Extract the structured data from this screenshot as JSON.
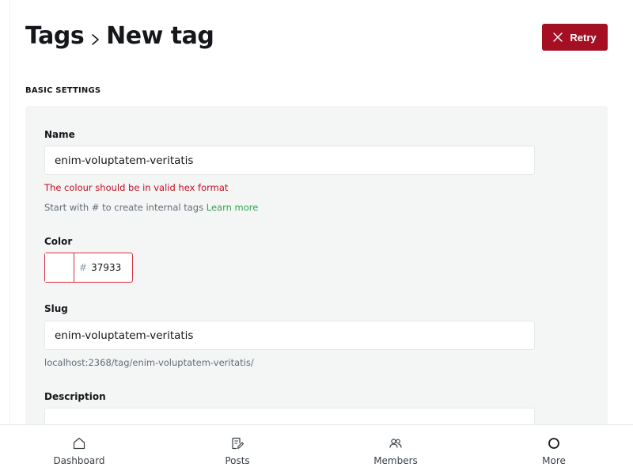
{
  "header": {
    "breadcrumb_parent": "Tags",
    "breadcrumb_current": "New tag",
    "retry_label": "Retry"
  },
  "section": {
    "title": "BASIC SETTINGS"
  },
  "form": {
    "name": {
      "label": "Name",
      "value": "enim-voluptatem-veritatis",
      "error": "The colour should be in valid hex format",
      "hint": "Start with # to create internal tags",
      "hint_link": "Learn more"
    },
    "color": {
      "label": "Color",
      "hash": "#",
      "value": "37933"
    },
    "slug": {
      "label": "Slug",
      "value": "enim-voluptatem-veritatis",
      "url_preview": "localhost:2368/tag/enim-voluptatem-veritatis/"
    },
    "description": {
      "label": "Description",
      "value": ""
    }
  },
  "bottom_nav": {
    "items": [
      {
        "label": "Dashboard",
        "icon": "house-icon"
      },
      {
        "label": "Posts",
        "icon": "edit-document-icon"
      },
      {
        "label": "Members",
        "icon": "members-icon"
      },
      {
        "label": "More",
        "icon": "circle-icon"
      }
    ]
  },
  "colors": {
    "retry_button": "#a50f24",
    "error_text": "#c40e23",
    "link": "#30a64a",
    "panel_background": "#f4f5f5"
  }
}
